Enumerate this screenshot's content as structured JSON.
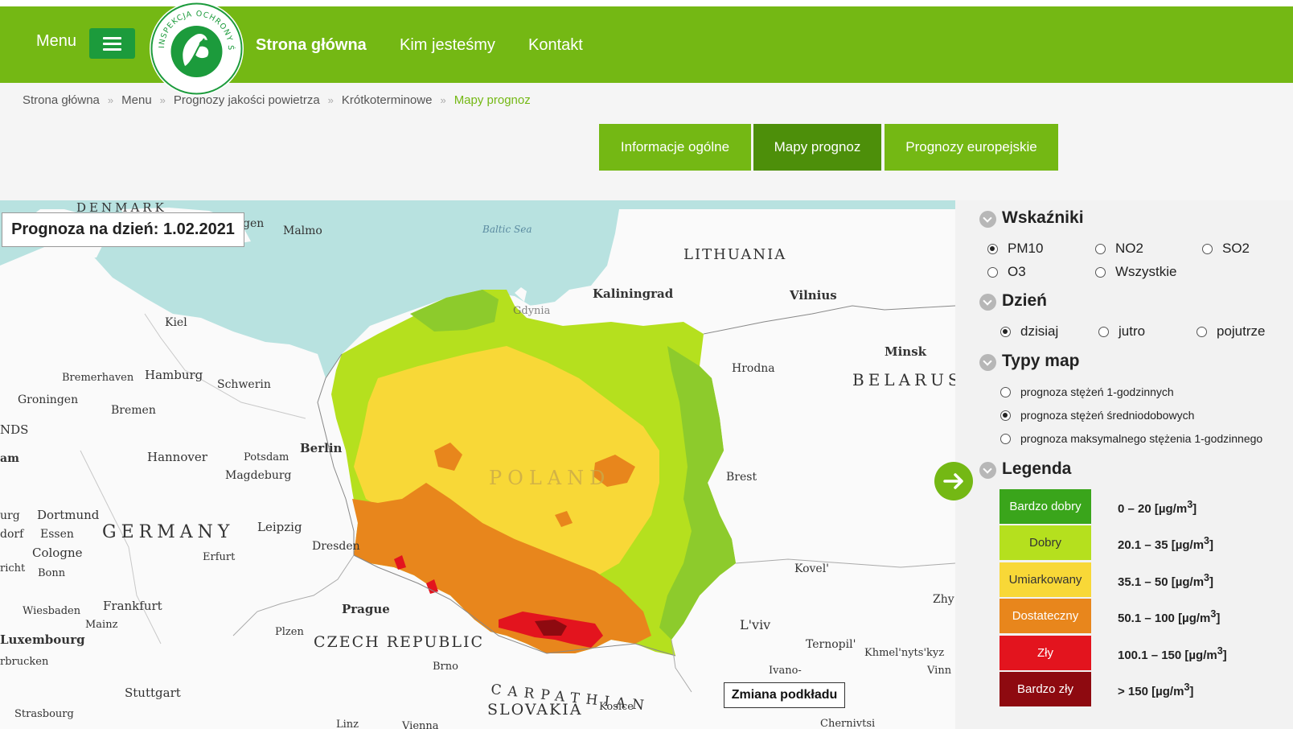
{
  "header": {
    "menu_label": "Menu",
    "logo_text": "INSPEKCJA OCHRONY ŚRODOWISKA",
    "nav": [
      {
        "label": "Strona główna"
      },
      {
        "label": "Kim jesteśmy"
      },
      {
        "label": "Kontakt"
      }
    ]
  },
  "breadcrumb": {
    "items": [
      "Strona główna",
      "Menu",
      "Prognozy jakości powietrza",
      "Krótkoterminowe"
    ],
    "separator": "»",
    "current": "Mapy prognoz"
  },
  "tabs": [
    {
      "label": "Informacje ogólne",
      "active": false
    },
    {
      "label": "Mapy prognoz",
      "active": true
    },
    {
      "label": "Prognozy europejskie",
      "active": false
    }
  ],
  "map": {
    "forecast_date": "Prognoza na dzień: 1.02.2021",
    "basemap_button": "Zmiana podkładu",
    "toggle_icon": "arrow-right-icon",
    "labels": {
      "denmark": "DENMARK",
      "sea": "Baltic Sea",
      "lithuania": "LITHUANIA",
      "belarus": "BELARUS",
      "germany": "GERMANY",
      "poland": "POLAND",
      "czech": "CZECH REPUBLIC",
      "slovakia": "SLOVAKIA",
      "carpathians": "CARPATHIAN",
      "malmo": "Malmo",
      "kiel": "Kiel",
      "hamburg": "Hamburg",
      "bremerhaven": "Bremerhaven",
      "bremen": "Bremen",
      "groningen": "Groningen",
      "schwerin": "Schwerin",
      "berlin": "Berlin",
      "potsdam": "Potsdam",
      "hannover": "Hannover",
      "magdeburg": "Magdeburg",
      "dortmund": "Dortmund",
      "essen": "Essen",
      "cologne": "Cologne",
      "bonn": "Bonn",
      "leipzig": "Leipzig",
      "dresden": "Dresden",
      "erfurt": "Erfurt",
      "frankfurt": "Frankfurt",
      "wiesbaden": "Wiesbaden",
      "mainz": "Mainz",
      "luxembourg": "Luxembourg",
      "stuttgart": "Stuttgart",
      "strasbourg": "Strasbourg",
      "prague": "Prague",
      "plzen": "Plzen",
      "brno": "Brno",
      "kaliningrad": "Kaliningrad",
      "vilnius": "Vilnius",
      "minsk": "Minsk",
      "hrodna": "Hrodna",
      "brest": "Brest",
      "kovel": "Kovel'",
      "lviv": "L'viv",
      "ternopil": "Ternopil'",
      "gdynia": "Gdynia",
      "khmelnytskyi": "Khmel'nyts'kyz",
      "kosice": "Kosice",
      "linz": "Linz",
      "vienna": "Vienna",
      "ivano": "Ivano-",
      "vinn": "Vinn",
      "zhy": "Zhy",
      "nds": "NDS",
      "am": "am",
      "urg": "urg",
      "dorf": "dorf",
      "richt": "richt",
      "rbrucken": "rbrucken",
      "chern": "Chernivtsi",
      "gen": "gen"
    }
  },
  "panel": {
    "indicators": {
      "title": "Wskaźniki",
      "options": [
        {
          "label": "PM10",
          "checked": true
        },
        {
          "label": "NO2",
          "checked": false
        },
        {
          "label": "SO2",
          "checked": false
        },
        {
          "label": "O3",
          "checked": false
        },
        {
          "label": "Wszystkie",
          "checked": false
        }
      ]
    },
    "day": {
      "title": "Dzień",
      "options": [
        {
          "label": "dzisiaj",
          "checked": true
        },
        {
          "label": "jutro",
          "checked": false
        },
        {
          "label": "pojutrze",
          "checked": false
        }
      ]
    },
    "map_types": {
      "title": "Typy map",
      "options": [
        {
          "label": "prognoza stężeń 1-godzinnych",
          "checked": false
        },
        {
          "label": "prognoza stężeń średniodobowych",
          "checked": true
        },
        {
          "label": "prognoza maksymalnego stężenia 1-godzinnego",
          "checked": false
        }
      ]
    },
    "legend": {
      "title": "Legenda",
      "unit_sup": "3",
      "items": [
        {
          "label": "Bardzo dobry",
          "range": "0 – 20 [µg/m",
          "color": "#3aa51b",
          "text_color": "#ffffff"
        },
        {
          "label": "Dobry",
          "range": "20.1 – 35 [µg/m",
          "color": "#b5e01e",
          "text_color": "#333333"
        },
        {
          "label": "Umiarkowany",
          "range": "35.1 – 50 [µg/m",
          "color": "#f8d837",
          "text_color": "#333333"
        },
        {
          "label": "Dostateczny",
          "range": "50.1 – 100 [µg/m",
          "color": "#e8861c",
          "text_color": "#ffffff"
        },
        {
          "label": "Zły",
          "range": "100.1 – 150 [µg/m",
          "color": "#e3141e",
          "text_color": "#ffffff"
        },
        {
          "label": "Bardzo zły",
          "range": "> 150 [µg/m",
          "color": "#8e0a10",
          "text_color": "#ffffff"
        }
      ]
    }
  }
}
